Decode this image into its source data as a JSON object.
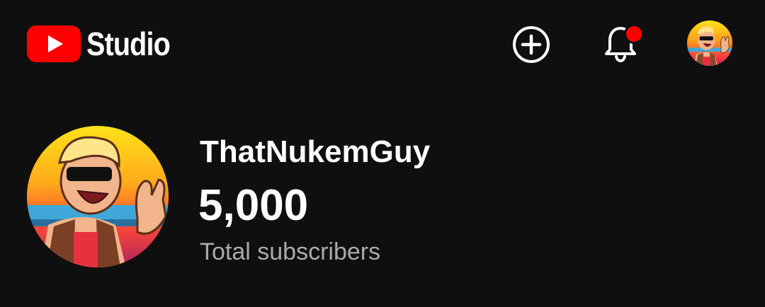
{
  "app": {
    "logo_text": "Studio"
  },
  "header": {
    "create_icon": "plus-circle-icon",
    "notifications_icon": "bell-icon",
    "notification_badge_color": "#ff0000",
    "account_icon": "avatar"
  },
  "channel": {
    "name": "ThatNukemGuy",
    "subscriber_count": "5,000",
    "subscriber_label": "Total subscribers"
  },
  "colors": {
    "background": "#0f0f0f",
    "brand_red": "#ff0000",
    "text_primary": "#ffffff",
    "text_secondary": "#aaaaaa"
  }
}
